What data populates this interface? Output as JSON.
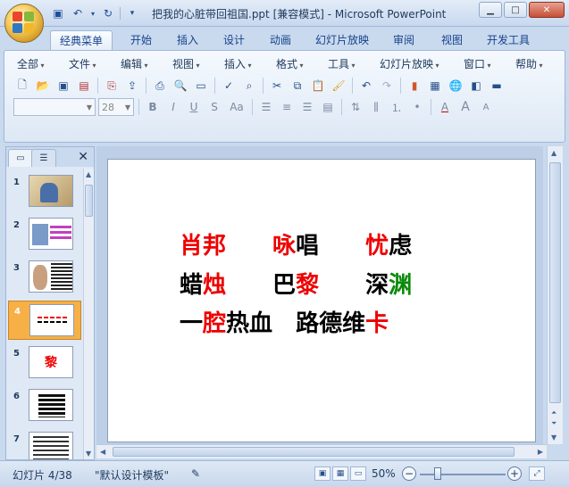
{
  "window": {
    "title": "把我的心脏带回祖国.ppt [兼容模式] - Microsoft PowerPoint"
  },
  "tabs": [
    {
      "label": "经典菜单",
      "active": true
    },
    {
      "label": "开始"
    },
    {
      "label": "插入"
    },
    {
      "label": "设计"
    },
    {
      "label": "动画"
    },
    {
      "label": "幻灯片放映"
    },
    {
      "label": "审阅"
    },
    {
      "label": "视图"
    },
    {
      "label": "开发工具"
    }
  ],
  "menus": [
    "全部",
    "文件",
    "编辑",
    "视图",
    "插入",
    "格式",
    "工具",
    "幻灯片放映",
    "窗口",
    "帮助"
  ],
  "format": {
    "font_name": "",
    "font_size": "28",
    "bold": "B",
    "italic": "I",
    "underline": "U",
    "shadow": "S",
    "case": "Aa",
    "color_a": "A",
    "grow": "A",
    "shrink": "A"
  },
  "slides": [
    {
      "num": "1"
    },
    {
      "num": "2"
    },
    {
      "num": "3"
    },
    {
      "num": "4",
      "selected": true,
      "preview": "肖邦 咏唱 忧虑"
    },
    {
      "num": "5",
      "preview": "黎"
    },
    {
      "num": "6"
    },
    {
      "num": "7"
    }
  ],
  "slide_content": {
    "line1": [
      {
        "t": "肖邦",
        "c": "red"
      },
      {
        "t": "　　"
      },
      {
        "t": "咏",
        "c": "red"
      },
      {
        "t": "唱"
      },
      {
        "t": "　　"
      },
      {
        "t": "忧",
        "c": "red"
      },
      {
        "t": "虑"
      }
    ],
    "line2": [
      {
        "t": "蜡"
      },
      {
        "t": "烛",
        "c": "red"
      },
      {
        "t": "　　"
      },
      {
        "t": "巴"
      },
      {
        "t": "黎",
        "c": "red"
      },
      {
        "t": "　　"
      },
      {
        "t": "深"
      },
      {
        "t": "渊",
        "c": "green"
      }
    ],
    "line3": [
      {
        "t": "一"
      },
      {
        "t": "腔",
        "c": "red"
      },
      {
        "t": "热血"
      },
      {
        "t": "　"
      },
      {
        "t": "路德维"
      },
      {
        "t": "卡",
        "c": "red"
      }
    ]
  },
  "status": {
    "slide_counter": "幻灯片 4/38",
    "template": "\"默认设计模板\"",
    "zoom": "50%"
  },
  "colors": {
    "highlight_red": "#ee0000",
    "highlight_green": "#0a8a0a",
    "selected_thumb": "#f6b046"
  }
}
